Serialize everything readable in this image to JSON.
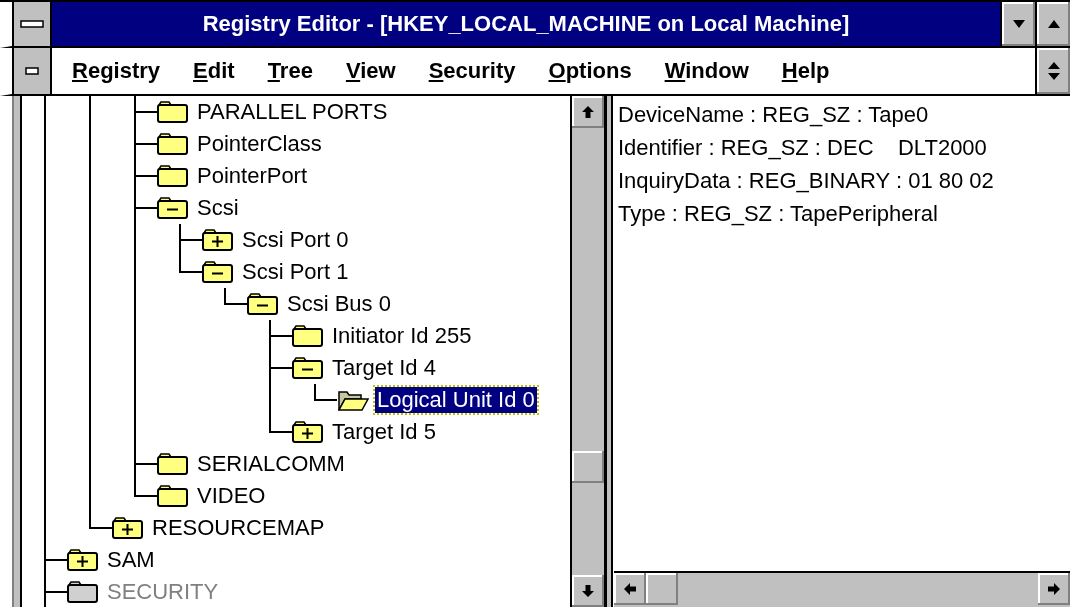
{
  "window": {
    "title": "Registry Editor - [HKEY_LOCAL_MACHINE on Local Machine]"
  },
  "menu": [
    {
      "key": "R",
      "rest": "egistry"
    },
    {
      "key": "E",
      "rest": "dit"
    },
    {
      "key": "T",
      "rest": "ree"
    },
    {
      "key": "V",
      "rest": "iew"
    },
    {
      "key": "S",
      "rest": "ecurity"
    },
    {
      "key": "O",
      "rest": "ptions"
    },
    {
      "key": "W",
      "rest": "indow"
    },
    {
      "key": "H",
      "rest": "elp"
    }
  ],
  "tree": {
    "items": [
      {
        "children": [
          {
            "children": [
              {
                "label": "PARALLEL PORTS",
                "kind": "leaf",
                "selected": false,
                "disabled": false
              },
              {
                "label": "PointerClass",
                "kind": "leaf",
                "selected": false,
                "disabled": false
              },
              {
                "label": "PointerPort",
                "kind": "leaf",
                "selected": false,
                "disabled": false
              },
              {
                "label": "Scsi",
                "kind": "branch",
                "expanded": true,
                "selected": false,
                "disabled": false,
                "children": [
                  {
                    "label": "Scsi Port 0",
                    "kind": "branch",
                    "expanded": false,
                    "selected": false,
                    "disabled": false
                  },
                  {
                    "label": "Scsi Port 1",
                    "kind": "branch",
                    "expanded": true,
                    "selected": false,
                    "disabled": false,
                    "children": [
                      {
                        "label": "Scsi Bus 0",
                        "kind": "branch",
                        "expanded": true,
                        "selected": false,
                        "disabled": false,
                        "children": [
                          {
                            "label": "Initiator Id 255",
                            "kind": "leaf",
                            "selected": false,
                            "disabled": false
                          },
                          {
                            "label": "Target Id 4",
                            "kind": "branch",
                            "expanded": true,
                            "selected": false,
                            "disabled": false,
                            "children": [
                              {
                                "label": "Logical Unit Id 0",
                                "kind": "leaf",
                                "selected": true,
                                "disabled": false
                              }
                            ]
                          },
                          {
                            "label": "Target Id 5",
                            "kind": "branch",
                            "expanded": false,
                            "selected": false,
                            "disabled": false
                          }
                        ]
                      }
                    ]
                  }
                ]
              },
              {
                "label": "SERIALCOMM",
                "kind": "leaf",
                "selected": false,
                "disabled": false
              },
              {
                "label": "VIDEO",
                "kind": "leaf",
                "selected": false,
                "disabled": false
              }
            ]
          },
          {
            "label": "RESOURCEMAP",
            "kind": "branch",
            "expanded": false,
            "selected": false,
            "disabled": false
          }
        ]
      },
      {
        "label": "SAM",
        "kind": "branch",
        "expanded": false,
        "selected": false,
        "disabled": false
      },
      {
        "label": "SECURITY",
        "kind": "leaf",
        "selected": false,
        "disabled": true,
        "continues": true
      }
    ]
  },
  "values": [
    "DeviceName : REG_SZ : Tape0",
    "Identifier : REG_SZ : DEC    DLT2000",
    "InquiryData : REG_BINARY : 01 80 02",
    "Type : REG_SZ : TapePeripheral"
  ]
}
